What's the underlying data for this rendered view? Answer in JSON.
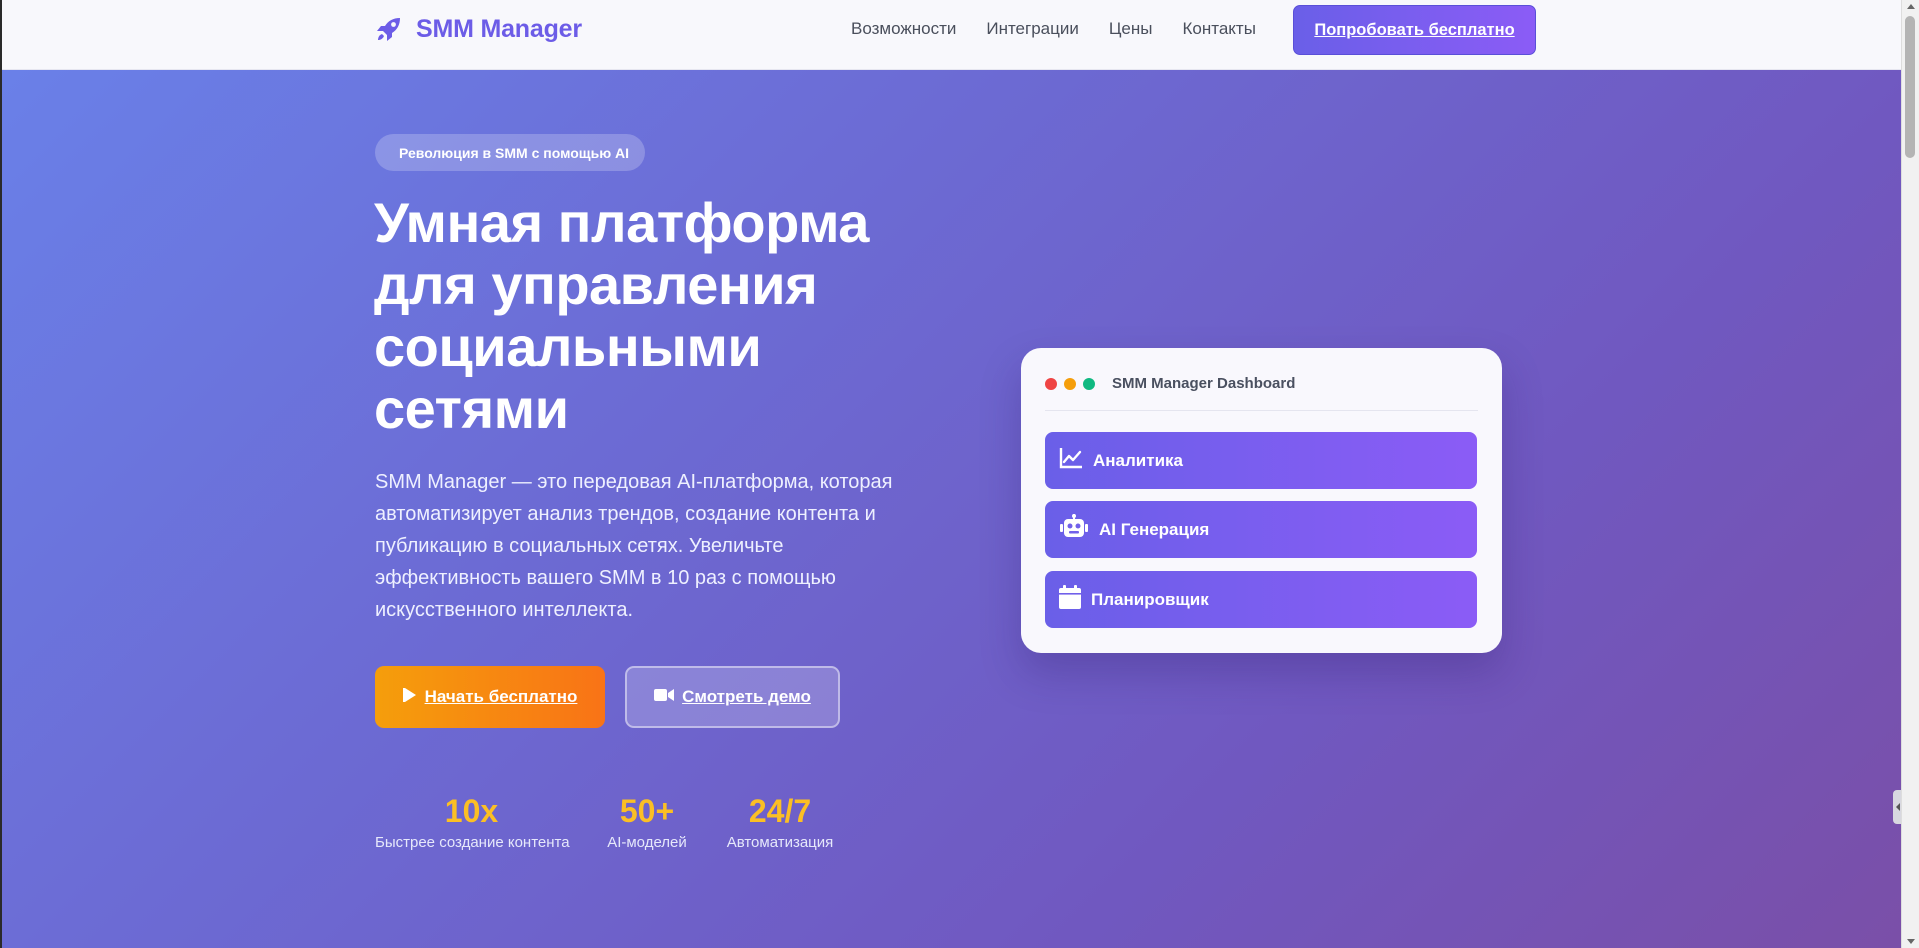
{
  "header": {
    "brand": "SMM Manager",
    "nav": [
      "Возможности",
      "Интеграции",
      "Цены",
      "Контакты"
    ],
    "cta": "Попробовать бесплатно"
  },
  "hero": {
    "badge": "Революция в SMM с помощью AI",
    "title_lines": [
      "Умная платформа",
      "для управления",
      "социальными",
      "сетями"
    ],
    "description_lines": [
      "SMM Manager — это передовая AI-платформа, которая",
      "автоматизирует анализ трендов, создание контента и",
      "публикацию в социальных сетях. Увеличьте",
      "эффективность вашего SMM в 10 раз с помощью",
      "искусственного интеллекта."
    ],
    "primary_button": "Начать бесплатно",
    "secondary_button": "Смотреть демо",
    "stats": [
      {
        "value": "10x",
        "label": "Быстрее создание контента"
      },
      {
        "value": "50+",
        "label": "AI-моделей"
      },
      {
        "value": "24/7",
        "label": "Автоматизация"
      }
    ]
  },
  "dashboard": {
    "title": "SMM Manager Dashboard",
    "items": [
      {
        "label": "Аналитика",
        "icon": "chart-line-icon"
      },
      {
        "label": "AI Генерация",
        "icon": "robot-icon"
      },
      {
        "label": "Планировщик",
        "icon": "calendar-icon"
      }
    ]
  },
  "colors": {
    "brand": "#6c5ce7",
    "accent": "#f97316",
    "stat": "#fbbf24",
    "window_dots": [
      "#ef4444",
      "#f59e0b",
      "#10b981"
    ]
  }
}
